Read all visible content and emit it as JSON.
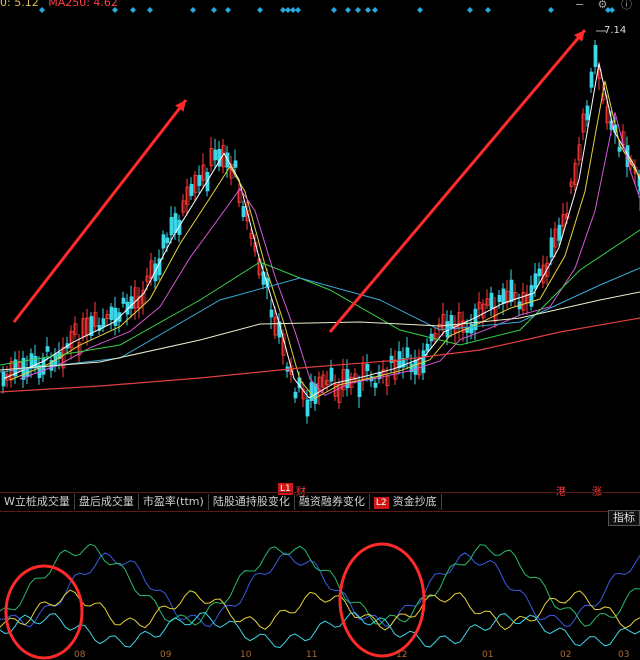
{
  "header": {
    "ma_text": "0: 5.12",
    "ma250_text": "MA250: 4.62"
  },
  "top_icons": [
    "restore-icon",
    "gear-icon",
    "info-icon"
  ],
  "top_icon_glyphs": [
    "−",
    "⚙",
    "ⓘ"
  ],
  "peak_label": "7.14",
  "events": [
    {
      "label": "L1",
      "badge": true
    },
    {
      "label": "财",
      "badge": false
    },
    {
      "label": "港",
      "badge": false
    },
    {
      "label": "涨",
      "badge": false
    }
  ],
  "tabs": [
    {
      "label": "W立桩成交量"
    },
    {
      "label": "盘后成交量"
    },
    {
      "label": "市盈率(ttm)"
    },
    {
      "label": "陆股通持股变化"
    },
    {
      "label": "融资融券变化"
    },
    {
      "label": "资金抄底",
      "badge": "L2"
    }
  ],
  "indicator_button": "指标",
  "x_labels": [
    "08",
    "09",
    "10",
    "11",
    "12",
    "01",
    "02",
    "03"
  ],
  "colors": {
    "up": "#ff3b3b",
    "down": "#3dd6e6",
    "ma5": "#ffffff",
    "ma10": "#e6d23a",
    "ma20": "#d85ad8",
    "ma30": "#3ad24a",
    "ma60": "#3aa8d8",
    "ma120": "#eeeecc",
    "ma250": "#e04040",
    "arrow": "#ff2a2a",
    "circle": "#ff2a2a"
  }
}
